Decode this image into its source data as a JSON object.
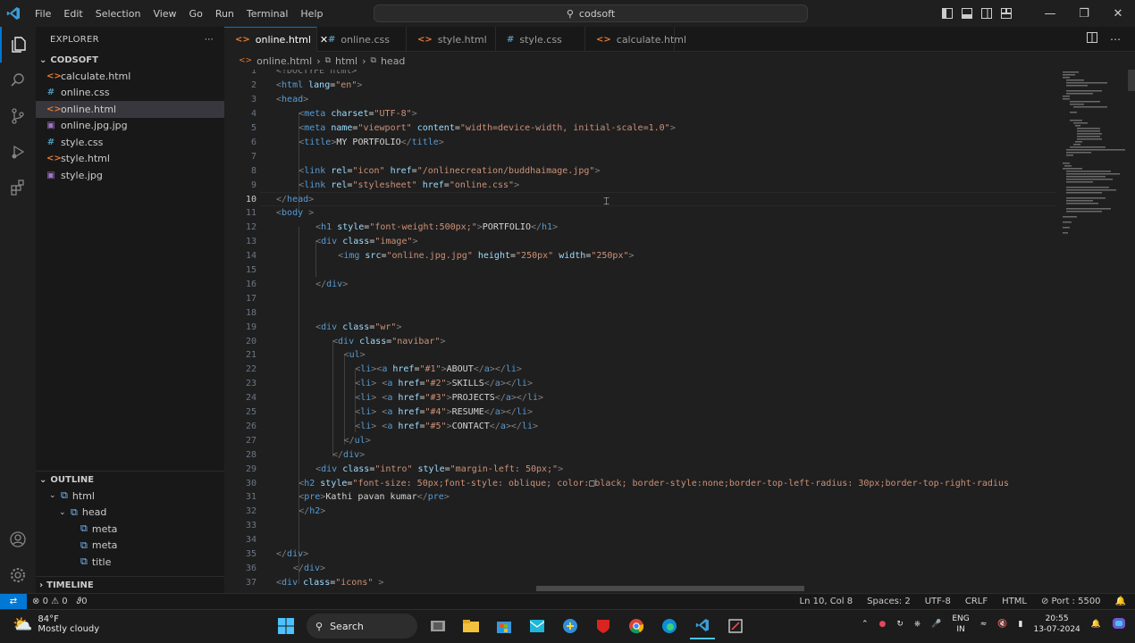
{
  "colors": {
    "accent": "#0078d4",
    "editor_bg": "#1f1f1f",
    "sidebar_bg": "#181818",
    "html_icon": "#e37933",
    "css_icon": "#519aba",
    "image_icon": "#a074c4"
  },
  "titlebar": {
    "menu": [
      "File",
      "Edit",
      "Selection",
      "View",
      "Go",
      "Run",
      "Terminal",
      "Help"
    ],
    "search_text": "codsoft",
    "icons": [
      "vscode-logo-icon",
      "back-arrow-icon",
      "forward-arrow-icon",
      "search-icon",
      "layout-icon",
      "minimize-icon",
      "maximize-icon",
      "close-icon"
    ]
  },
  "explorer": {
    "header": "EXPLORER",
    "folder": "CODSOFT",
    "files": [
      {
        "name": "calculate.html",
        "icon": "html-file-icon",
        "selected": false
      },
      {
        "name": "online.css",
        "icon": "css-file-icon",
        "selected": false
      },
      {
        "name": "online.html",
        "icon": "html-file-icon",
        "selected": true
      },
      {
        "name": "online.jpg.jpg",
        "icon": "image-file-icon",
        "selected": false
      },
      {
        "name": "style.css",
        "icon": "css-file-icon",
        "selected": false
      },
      {
        "name": "style.html",
        "icon": "html-file-icon",
        "selected": false
      },
      {
        "name": "style.jpg",
        "icon": "image-file-icon",
        "selected": false
      }
    ]
  },
  "outline": {
    "header": "OUTLINE",
    "items": [
      {
        "label": "html",
        "indent": 1
      },
      {
        "label": "head",
        "indent": 2
      },
      {
        "label": "meta",
        "indent": 3
      },
      {
        "label": "meta",
        "indent": 3
      },
      {
        "label": "title",
        "indent": 3
      }
    ]
  },
  "timeline": {
    "header": "TIMELINE"
  },
  "tabs": [
    {
      "label": "online.html",
      "icon": "html-file-icon",
      "active": true
    },
    {
      "label": "online.css",
      "icon": "css-file-icon",
      "active": false
    },
    {
      "label": "style.html",
      "icon": "html-file-icon",
      "active": false
    },
    {
      "label": "style.css",
      "icon": "css-file-icon",
      "active": false
    },
    {
      "label": "calculate.html",
      "icon": "html-file-icon",
      "active": false
    }
  ],
  "breadcrumb": [
    "online.html",
    "html",
    "head"
  ],
  "editor": {
    "current_line": 10,
    "lines": [
      {
        "n": "1",
        "indent": 0,
        "parts": [
          [
            "p",
            "<!DOCTYPE html>"
          ]
        ]
      },
      {
        "n": "2",
        "indent": 0,
        "parts": [
          [
            "p",
            "<"
          ],
          [
            "t",
            "html"
          ],
          [
            "a",
            " lang"
          ],
          [
            "x",
            "="
          ],
          [
            "s",
            "\"en\""
          ],
          [
            "p",
            ">"
          ]
        ]
      },
      {
        "n": "3",
        "indent": 0,
        "parts": [
          [
            "p",
            "<"
          ],
          [
            "t",
            "head"
          ],
          [
            "p",
            ">"
          ]
        ]
      },
      {
        "n": "4",
        "indent": 4,
        "parts": [
          [
            "p",
            "<"
          ],
          [
            "t",
            "meta"
          ],
          [
            "a",
            " charset"
          ],
          [
            "x",
            "="
          ],
          [
            "s",
            "\"UTF-8\""
          ],
          [
            "p",
            ">"
          ]
        ]
      },
      {
        "n": "5",
        "indent": 4,
        "parts": [
          [
            "p",
            "<"
          ],
          [
            "t",
            "meta"
          ],
          [
            "a",
            " name"
          ],
          [
            "x",
            "="
          ],
          [
            "s",
            "\"viewport\""
          ],
          [
            "a",
            " content"
          ],
          [
            "x",
            "="
          ],
          [
            "s",
            "\"width=device-width, initial-scale=1.0\""
          ],
          [
            "p",
            ">"
          ]
        ]
      },
      {
        "n": "6",
        "indent": 4,
        "parts": [
          [
            "p",
            "<"
          ],
          [
            "t",
            "title"
          ],
          [
            "p",
            ">"
          ],
          [
            "x",
            "MY PORTFOLIO"
          ],
          [
            "p",
            "</"
          ],
          [
            "t",
            "title"
          ],
          [
            "p",
            ">"
          ]
        ]
      },
      {
        "n": "7",
        "indent": 0,
        "parts": []
      },
      {
        "n": "8",
        "indent": 4,
        "parts": [
          [
            "p",
            "<"
          ],
          [
            "t",
            "link"
          ],
          [
            "a",
            " rel"
          ],
          [
            "x",
            "="
          ],
          [
            "s",
            "\"icon\""
          ],
          [
            "a",
            " href"
          ],
          [
            "x",
            "="
          ],
          [
            "s",
            "\"/onlinecreation/buddhaimage.jpg\""
          ],
          [
            "p",
            ">"
          ]
        ]
      },
      {
        "n": "9",
        "indent": 4,
        "parts": [
          [
            "p",
            "<"
          ],
          [
            "t",
            "link"
          ],
          [
            "a",
            " rel"
          ],
          [
            "x",
            "="
          ],
          [
            "s",
            "\"stylesheet\""
          ],
          [
            "a",
            " href"
          ],
          [
            "x",
            "="
          ],
          [
            "s",
            "\"online.css\""
          ],
          [
            "p",
            ">"
          ]
        ]
      },
      {
        "n": "10",
        "indent": 0,
        "parts": [
          [
            "p",
            "</"
          ],
          [
            "t",
            "head"
          ],
          [
            "p",
            ">"
          ]
        ]
      },
      {
        "n": "11",
        "indent": 0,
        "parts": [
          [
            "p",
            "<"
          ],
          [
            "t",
            "body"
          ],
          [
            "p",
            " >"
          ]
        ]
      },
      {
        "n": "12",
        "indent": 7,
        "parts": [
          [
            "p",
            "<"
          ],
          [
            "t",
            "h1"
          ],
          [
            "a",
            " style"
          ],
          [
            "x",
            "="
          ],
          [
            "s",
            "\"font-weight:500px;\""
          ],
          [
            "p",
            ">"
          ],
          [
            "x",
            "PORTFOLIO"
          ],
          [
            "p",
            "</"
          ],
          [
            "t",
            "h1"
          ],
          [
            "p",
            ">"
          ]
        ]
      },
      {
        "n": "13",
        "indent": 7,
        "parts": [
          [
            "p",
            "<"
          ],
          [
            "t",
            "div"
          ],
          [
            "a",
            " class"
          ],
          [
            "x",
            "="
          ],
          [
            "s",
            "\"image\""
          ],
          [
            "p",
            ">"
          ]
        ]
      },
      {
        "n": "14",
        "indent": 11,
        "parts": [
          [
            "p",
            "<"
          ],
          [
            "t",
            "img"
          ],
          [
            "a",
            " src"
          ],
          [
            "x",
            "="
          ],
          [
            "s",
            "\"online.jpg.jpg\""
          ],
          [
            "a",
            " height"
          ],
          [
            "x",
            "="
          ],
          [
            "s",
            "\"250px\""
          ],
          [
            "a",
            " width"
          ],
          [
            "x",
            "="
          ],
          [
            "s",
            "\"250px\""
          ],
          [
            "p",
            ">"
          ]
        ]
      },
      {
        "n": "15",
        "indent": 0,
        "parts": []
      },
      {
        "n": "16",
        "indent": 7,
        "parts": [
          [
            "p",
            "</"
          ],
          [
            "t",
            "div"
          ],
          [
            "p",
            ">"
          ]
        ]
      },
      {
        "n": "17",
        "indent": 0,
        "parts": []
      },
      {
        "n": "18",
        "indent": 0,
        "parts": []
      },
      {
        "n": "19",
        "indent": 7,
        "parts": [
          [
            "p",
            "<"
          ],
          [
            "t",
            "div"
          ],
          [
            "a",
            " class"
          ],
          [
            "x",
            "="
          ],
          [
            "s",
            "\"wr\""
          ],
          [
            "p",
            ">"
          ]
        ]
      },
      {
        "n": "20",
        "indent": 10,
        "parts": [
          [
            "p",
            "<"
          ],
          [
            "t",
            "div"
          ],
          [
            "a",
            " class"
          ],
          [
            "x",
            "="
          ],
          [
            "s",
            "\"navibar\""
          ],
          [
            "p",
            ">"
          ]
        ]
      },
      {
        "n": "21",
        "indent": 12,
        "parts": [
          [
            "p",
            "<"
          ],
          [
            "t",
            "ul"
          ],
          [
            "p",
            ">"
          ]
        ]
      },
      {
        "n": "22",
        "indent": 14,
        "parts": [
          [
            "p",
            "<"
          ],
          [
            "t",
            "li"
          ],
          [
            "p",
            "><"
          ],
          [
            "t",
            "a"
          ],
          [
            "a",
            " href"
          ],
          [
            "x",
            "="
          ],
          [
            "s",
            "\"#1\""
          ],
          [
            "p",
            ">"
          ],
          [
            "x",
            "ABOUT"
          ],
          [
            "p",
            "</"
          ],
          [
            "t",
            "a"
          ],
          [
            "p",
            "></"
          ],
          [
            "t",
            "li"
          ],
          [
            "p",
            ">"
          ]
        ]
      },
      {
        "n": "23",
        "indent": 14,
        "parts": [
          [
            "p",
            "<"
          ],
          [
            "t",
            "li"
          ],
          [
            "p",
            "> <"
          ],
          [
            "t",
            "a"
          ],
          [
            "a",
            " href"
          ],
          [
            "x",
            "="
          ],
          [
            "s",
            "\"#2\""
          ],
          [
            "p",
            ">"
          ],
          [
            "x",
            "SKILLS"
          ],
          [
            "p",
            "</"
          ],
          [
            "t",
            "a"
          ],
          [
            "p",
            "></"
          ],
          [
            "t",
            "li"
          ],
          [
            "p",
            ">"
          ]
        ]
      },
      {
        "n": "24",
        "indent": 14,
        "parts": [
          [
            "p",
            "<"
          ],
          [
            "t",
            "li"
          ],
          [
            "p",
            "> <"
          ],
          [
            "t",
            "a"
          ],
          [
            "a",
            " href"
          ],
          [
            "x",
            "="
          ],
          [
            "s",
            "\"#3\""
          ],
          [
            "p",
            ">"
          ],
          [
            "x",
            "PROJECTS"
          ],
          [
            "p",
            "</"
          ],
          [
            "t",
            "a"
          ],
          [
            "p",
            "></"
          ],
          [
            "t",
            "li"
          ],
          [
            "p",
            ">"
          ]
        ]
      },
      {
        "n": "25",
        "indent": 14,
        "parts": [
          [
            "p",
            "<"
          ],
          [
            "t",
            "li"
          ],
          [
            "p",
            "> <"
          ],
          [
            "t",
            "a"
          ],
          [
            "a",
            " href"
          ],
          [
            "x",
            "="
          ],
          [
            "s",
            "\"#4\""
          ],
          [
            "p",
            ">"
          ],
          [
            "x",
            "RESUME"
          ],
          [
            "p",
            "</"
          ],
          [
            "t",
            "a"
          ],
          [
            "p",
            "></"
          ],
          [
            "t",
            "li"
          ],
          [
            "p",
            ">"
          ]
        ]
      },
      {
        "n": "26",
        "indent": 14,
        "parts": [
          [
            "p",
            "<"
          ],
          [
            "t",
            "li"
          ],
          [
            "p",
            "> <"
          ],
          [
            "t",
            "a"
          ],
          [
            "a",
            " href"
          ],
          [
            "x",
            "="
          ],
          [
            "s",
            "\"#5\""
          ],
          [
            "p",
            ">"
          ],
          [
            "x",
            "CONTACT"
          ],
          [
            "p",
            "</"
          ],
          [
            "t",
            "a"
          ],
          [
            "p",
            "></"
          ],
          [
            "t",
            "li"
          ],
          [
            "p",
            ">"
          ]
        ]
      },
      {
        "n": "27",
        "indent": 12,
        "parts": [
          [
            "p",
            "</"
          ],
          [
            "t",
            "ul"
          ],
          [
            "p",
            ">"
          ]
        ]
      },
      {
        "n": "28",
        "indent": 10,
        "parts": [
          [
            "p",
            "</"
          ],
          [
            "t",
            "div"
          ],
          [
            "p",
            ">"
          ]
        ]
      },
      {
        "n": "29",
        "indent": 7,
        "parts": [
          [
            "p",
            "<"
          ],
          [
            "t",
            "div"
          ],
          [
            "a",
            " class"
          ],
          [
            "x",
            "="
          ],
          [
            "s",
            "\"intro\""
          ],
          [
            "a",
            " style"
          ],
          [
            "x",
            "="
          ],
          [
            "s",
            "\"margin-left: 50px;\""
          ],
          [
            "p",
            ">"
          ]
        ]
      },
      {
        "n": "30",
        "indent": 4,
        "parts": [
          [
            "p",
            "<"
          ],
          [
            "t",
            "h2"
          ],
          [
            "a",
            " style"
          ],
          [
            "x",
            "="
          ],
          [
            "s",
            "\"font-size: 50px;font-style: oblique; color:"
          ],
          [
            "x",
            "□"
          ],
          [
            "s",
            "black; border-style:none;border-top-left-radius: 30px;border-top-right-radius"
          ]
        ]
      },
      {
        "n": "31",
        "indent": 4,
        "parts": [
          [
            "p",
            "<"
          ],
          [
            "t",
            "pre"
          ],
          [
            "p",
            ">"
          ],
          [
            "x",
            "Kathi pavan kumar"
          ],
          [
            "p",
            "</"
          ],
          [
            "t",
            "pre"
          ],
          [
            "p",
            ">"
          ]
        ]
      },
      {
        "n": "32",
        "indent": 4,
        "parts": [
          [
            "p",
            "</"
          ],
          [
            "t",
            "h2"
          ],
          [
            "p",
            ">"
          ]
        ]
      },
      {
        "n": "33",
        "indent": 0,
        "parts": []
      },
      {
        "n": "34",
        "indent": 0,
        "parts": []
      },
      {
        "n": "35",
        "indent": 0,
        "parts": [
          [
            "p",
            "</"
          ],
          [
            "t",
            "div"
          ],
          [
            "p",
            ">"
          ]
        ]
      },
      {
        "n": "36",
        "indent": 3,
        "parts": [
          [
            "p",
            "</"
          ],
          [
            "t",
            "div"
          ],
          [
            "p",
            ">"
          ]
        ]
      },
      {
        "n": "37",
        "indent": 0,
        "parts": [
          [
            "p",
            "<"
          ],
          [
            "t",
            "div"
          ],
          [
            "a",
            " class"
          ],
          [
            "x",
            "="
          ],
          [
            "s",
            "\"icons\""
          ],
          [
            "p",
            " >"
          ]
        ]
      }
    ]
  },
  "statusbar": {
    "errors": "0",
    "warnings": "0",
    "ports_forwarded": "0",
    "cursor": "Ln 10, Col 8",
    "spaces": "Spaces: 2",
    "encoding": "UTF-8",
    "eol": "CRLF",
    "language": "HTML",
    "port": "Port : 5500"
  },
  "taskbar": {
    "weather_temp": "84°F",
    "weather_desc": "Mostly cloudy",
    "search_label": "Search",
    "lang_line1": "ENG",
    "lang_line2": "IN",
    "time": "20:55",
    "date": "13-07-2024"
  }
}
